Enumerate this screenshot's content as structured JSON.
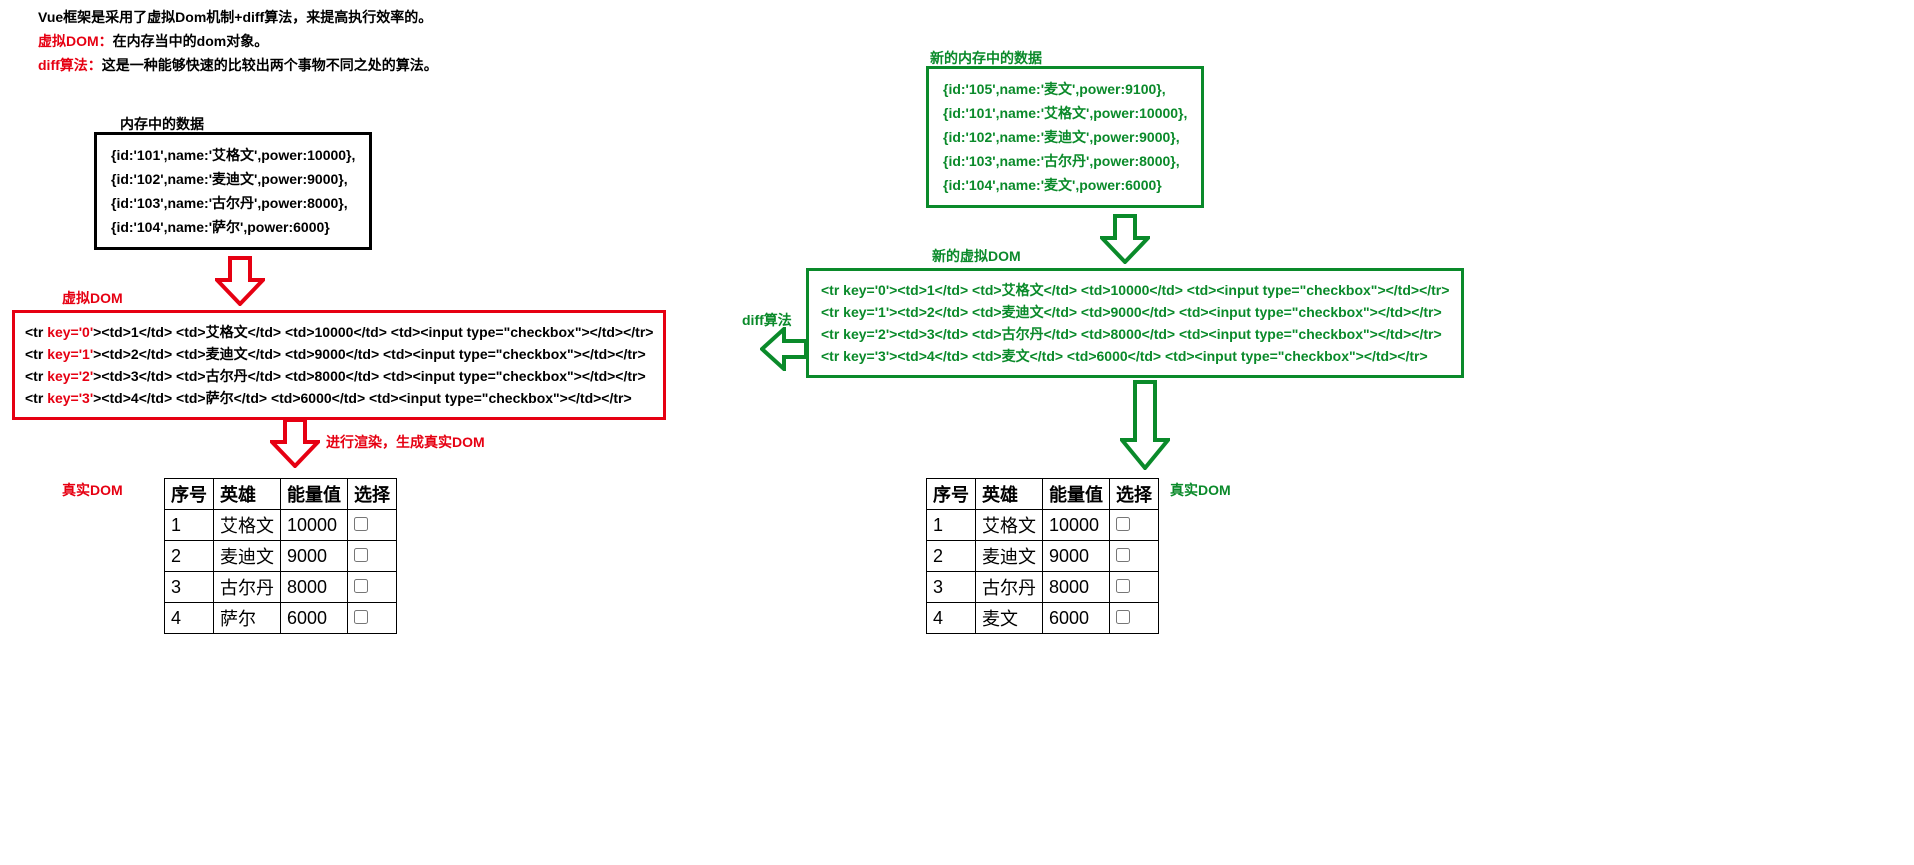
{
  "header": {
    "line1": "Vue框架是采用了虚拟Dom机制+diff算法，来提高执行效率的。",
    "line2_label": "虚拟DOM：",
    "line2_text": "在内存当中的dom对象。",
    "line3_label": "diff算法：",
    "line3_text": "这是一种能够快速的比较出两个事物不同之处的算法。"
  },
  "left": {
    "mem_label": "内存中的数据",
    "data_lines": [
      "{id:'101',name:'艾格文',power:10000},",
      "{id:'102',name:'麦迪文',power:9000},",
      "{id:'103',name:'古尔丹',power:8000},",
      "{id:'104',name:'萨尔',power:6000}"
    ],
    "vdom_label": "虚拟DOM",
    "vdom_lines": [
      {
        "key": "key='0'",
        "rest": "><td>1</td> <td>艾格文</td> <td>10000</td> <td><input type=\"checkbox\"></td></tr>"
      },
      {
        "key": "key='1'",
        "rest": "><td>2</td> <td>麦迪文</td> <td>9000</td> <td><input type=\"checkbox\"></td></tr>"
      },
      {
        "key": "key='2'",
        "rest": "><td>3</td> <td>古尔丹</td> <td>8000</td> <td><input type=\"checkbox\"></td></tr>"
      },
      {
        "key": "key='3'",
        "rest": "><td>4</td> <td>萨尔</td> <td>6000</td> <td><input type=\"checkbox\"></td></tr>"
      }
    ],
    "render_label": "进行渲染，生成真实DOM",
    "realdom_label": "真实DOM",
    "table_headers": [
      "序号",
      "英雄",
      "能量值",
      "选择"
    ],
    "table_rows": [
      [
        "1",
        "艾格文",
        "10000"
      ],
      [
        "2",
        "麦迪文",
        "9000"
      ],
      [
        "3",
        "古尔丹",
        "8000"
      ],
      [
        "4",
        "萨尔",
        "6000"
      ]
    ]
  },
  "right": {
    "mem_label": "新的内存中的数据",
    "data_lines": [
      "{id:'105',name:'麦文',power:9100},",
      "{id:'101',name:'艾格文',power:10000},",
      "{id:'102',name:'麦迪文',power:9000},",
      "{id:'103',name:'古尔丹',power:8000},",
      "{id:'104',name:'麦文',power:6000}"
    ],
    "vdom_label": "新的虚拟DOM",
    "vdom_lines": [
      "<tr key='0'><td>1</td> <td>艾格文</td> <td>10000</td> <td><input type=\"checkbox\"></td></tr>",
      "<tr key='1'><td>2</td> <td>麦迪文</td> <td>9000</td> <td><input type=\"checkbox\"></td></tr>",
      "<tr key='2'><td>3</td> <td>古尔丹</td> <td>8000</td> <td><input type=\"checkbox\"></td></tr>",
      "<tr key='3'><td>4</td> <td>麦文</td> <td>6000</td> <td><input type=\"checkbox\"></td></tr>"
    ],
    "diff_label": "diff算法",
    "realdom_label": "真实DOM",
    "table_headers": [
      "序号",
      "英雄",
      "能量值",
      "选择"
    ],
    "table_rows": [
      [
        "1",
        "艾格文",
        "10000"
      ],
      [
        "2",
        "麦迪文",
        "9000"
      ],
      [
        "3",
        "古尔丹",
        "8000"
      ],
      [
        "4",
        "麦文",
        "6000"
      ]
    ]
  },
  "colors": {
    "red": "#e60012",
    "green": "#0a8a2a",
    "black": "#000000"
  }
}
